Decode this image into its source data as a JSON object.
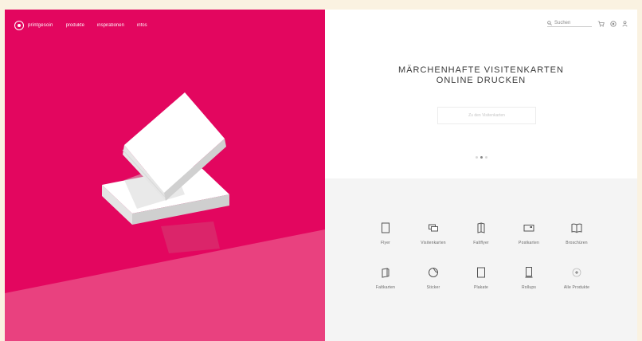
{
  "brand": {
    "name": "printgesoin"
  },
  "nav": {
    "items": [
      "produkte",
      "inspirationen",
      "infos"
    ]
  },
  "utilities": {
    "search_label": "Suchen"
  },
  "hero": {
    "headline_line1": "MÄRCHENHAFTE VISITENKARTEN",
    "headline_line2": "ONLINE DRUCKEN",
    "cta_label": "Zu den Visitenkarten"
  },
  "products": [
    {
      "label": "Flyer",
      "icon": "flyer-icon"
    },
    {
      "label": "Visitenkarten",
      "icon": "business-card-icon"
    },
    {
      "label": "Faltflyer",
      "icon": "folded-flyer-icon"
    },
    {
      "label": "Postkarten",
      "icon": "postcard-icon"
    },
    {
      "label": "Broschüren",
      "icon": "brochure-icon"
    },
    {
      "label": "Faltkarten",
      "icon": "folded-card-icon"
    },
    {
      "label": "Sticker",
      "icon": "sticker-icon"
    },
    {
      "label": "Plakate",
      "icon": "poster-icon"
    },
    {
      "label": "Rollups",
      "icon": "rollup-icon"
    },
    {
      "label": "Alle Produkte",
      "icon": "plus-icon"
    }
  ],
  "colors": {
    "hero_pink": "#e3065f",
    "floor_pink": "#e9417f",
    "accent_gray": "#8b8b8b"
  }
}
